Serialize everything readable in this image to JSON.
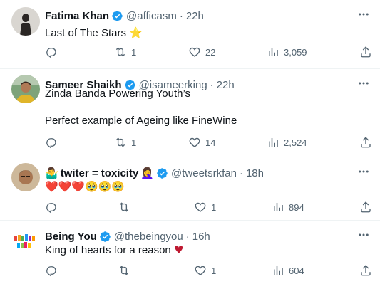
{
  "tweets": [
    {
      "name": "Fatima Khan",
      "handle": "@afficasm",
      "time": "22h",
      "text_lines": [
        "Last of The Stars"
      ],
      "emoji_suffix": "⭐",
      "replies": "",
      "retweets": "1",
      "likes": "22",
      "views": "3,059",
      "avatar_icon": "dark-silhouette-avatar"
    },
    {
      "name": "Sameer Shaikh",
      "handle": "@isameerking",
      "time": "22h",
      "text_lines": [
        "Zinda Banda Powering Youth’s",
        "",
        "Perfect example of Ageing like FineWine"
      ],
      "replies": "",
      "retweets": "1",
      "likes": "14",
      "views": "2,524",
      "avatar_icon": "man-yellow-shirt-avatar"
    },
    {
      "name_prefix_emoji": "🤷‍♂️",
      "name": "twiter = toxicity",
      "name_suffix_emoji": "🤦‍♀️",
      "handle": "@tweetsrkfan",
      "time": "18h",
      "text_lines": [
        "❤️❤️❤️🥹🥹🥹"
      ],
      "replies": "",
      "retweets": "",
      "likes": "1",
      "views": "894",
      "avatar_icon": "man-portrait-avatar"
    },
    {
      "name": "Being You",
      "handle": "@thebeingyou",
      "time": "16h",
      "text_lines": [
        "King of hearts for a reason"
      ],
      "emoji_suffix": "♥",
      "replies": "",
      "retweets": "",
      "likes": "1",
      "views": "604",
      "avatar_icon": "colorful-text-logo-avatar"
    }
  ],
  "colors": {
    "verified": "#1d9bf0",
    "icon_gray": "#536471",
    "heart_red": "#be1931",
    "star": "#f4b400"
  },
  "icons": {
    "reply": "reply-icon",
    "retweet": "retweet-icon",
    "like": "like-icon",
    "views": "views-icon",
    "share": "share-icon",
    "more": "more-icon",
    "verified": "verified-badge-icon"
  }
}
